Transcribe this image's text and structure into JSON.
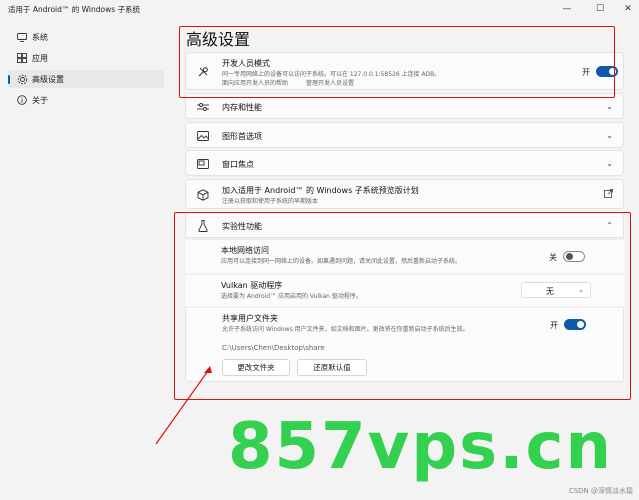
{
  "window": {
    "title": "适用于 Android™ 的 Windows 子系统",
    "minimize": "—",
    "maximize": "☐",
    "close": "✕"
  },
  "sidebar": {
    "items": [
      {
        "label": "系统",
        "icon": "system-icon",
        "active": false
      },
      {
        "label": "应用",
        "icon": "apps-icon",
        "active": false
      },
      {
        "label": "高级设置",
        "icon": "gear-icon",
        "active": true
      },
      {
        "label": "关于",
        "icon": "info-icon",
        "active": false
      }
    ]
  },
  "page": {
    "title": "高级设置"
  },
  "developer": {
    "title": "开发人员模式",
    "desc": "同一专用网络上的设备可以访问子系统。可以在 127.0.0.1:58526 上连接 ADB。",
    "link1": "面向应用开发人员的帮助",
    "link2": "管理开发人员设置",
    "toggle_label": "开"
  },
  "sections": {
    "memory": "内存和性能",
    "graphics": "图形首选项",
    "focus": "窗口焦点",
    "preview_title": "加入适用于 Android™ 的 Windows 子系统预览版计划",
    "preview_desc": "注册以获取和使用子系统的早期版本"
  },
  "experimental": {
    "title": "实验性功能",
    "local_net_title": "本地网络访问",
    "local_net_desc": "应用可以连接到同一网络上的设备。如果遇到问题，请关闭此设置，然后重新启动子系统。",
    "local_net_toggle": "关",
    "vulkan_title": "Vulkan 驱动程序",
    "vulkan_desc": "选择要为 Android™ 应用启用的 Vulkan 驱动程序。",
    "vulkan_value": "无",
    "shared_title": "共享用户文件夹",
    "shared_desc": "允许子系统访问 Windows 用户文件夹，如文档和图片。更改将在你重新启动子系统后生效。",
    "shared_toggle": "开",
    "shared_path": "C:\\Users\\Chen\\Desktop\\share",
    "change_btn": "更改文件夹",
    "reset_btn": "还原默认值"
  },
  "watermark": "857vps.cn",
  "footer": "CSDN @深情淡水猿",
  "colors": {
    "accent": "#0f5aa8",
    "highlight": "#dd1111",
    "watermark": "#33d14f"
  }
}
